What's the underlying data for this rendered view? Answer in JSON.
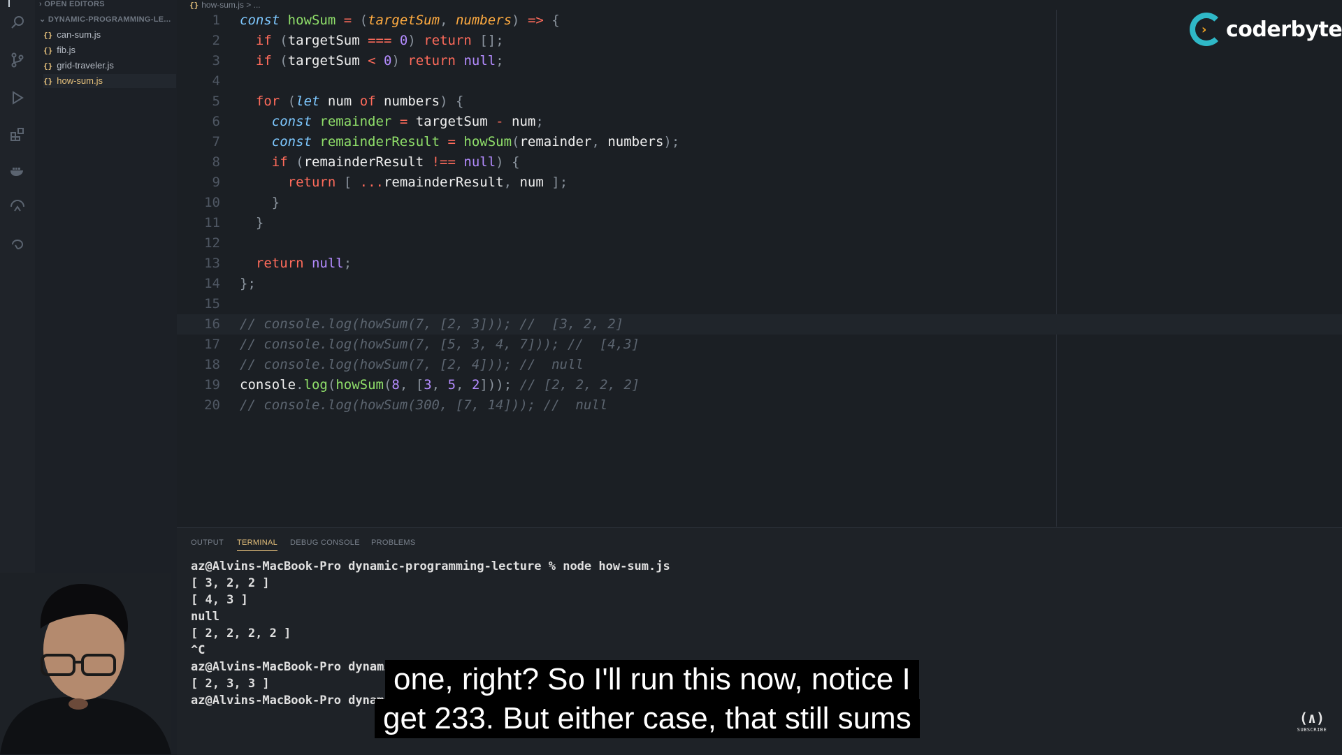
{
  "activity_bar": {
    "icons": [
      "files-icon",
      "search-icon",
      "source-control-icon",
      "run-debug-icon",
      "extensions-icon",
      "docker-icon",
      "remote-icon",
      "live-share-icon"
    ]
  },
  "sidebar": {
    "open_editors": "OPEN EDITORS",
    "folder": "DYNAMIC-PROGRAMMING-LE...",
    "files": [
      {
        "icon": "{}",
        "name": "can-sum.js"
      },
      {
        "icon": "{}",
        "name": "fib.js"
      },
      {
        "icon": "{}",
        "name": "grid-traveler.js"
      },
      {
        "icon": "{}",
        "name": "how-sum.js"
      }
    ]
  },
  "editor": {
    "breadcrumb": "how-sum.js > ...",
    "breadcrumb_icon": "{}",
    "line_numbers": [
      "1",
      "2",
      "3",
      "4",
      "5",
      "6",
      "7",
      "8",
      "9",
      "10",
      "11",
      "12",
      "13",
      "14",
      "15",
      "16",
      "17",
      "18",
      "19",
      "20"
    ],
    "code": {
      "l1": {
        "a": "const",
        "b": "howSum",
        "c": "=",
        "d": "(",
        "e": "targetSum",
        "f": ",",
        "g": "numbers",
        "h": ")",
        "i": "=>",
        "j": "{"
      },
      "l2": {
        "a": "if",
        "b": "(",
        "c": "targetSum",
        "d": "===",
        "e": "0",
        "f": ")",
        "g": "return",
        "h": "[];"
      },
      "l3": {
        "a": "if",
        "b": "(",
        "c": "targetSum",
        "d": "<",
        "e": "0",
        "f": ")",
        "g": "return",
        "h": "null",
        "i": ";"
      },
      "l5": {
        "a": "for",
        "b": "(",
        "c": "let",
        "d": "num",
        "e": "of",
        "f": "numbers",
        "g": ")",
        "h": "{"
      },
      "l6": {
        "a": "const",
        "b": "remainder",
        "c": "=",
        "d": "targetSum",
        "e": "-",
        "f": "num",
        "g": ";"
      },
      "l7": {
        "a": "const",
        "b": "remainderResult",
        "c": "=",
        "d": "howSum",
        "e": "(",
        "f": "remainder",
        "g": ",",
        "h": "numbers",
        "i": ");"
      },
      "l8": {
        "a": "if",
        "b": "(",
        "c": "remainderResult",
        "d": "!==",
        "e": "null",
        "f": ")",
        "g": "{"
      },
      "l9": {
        "a": "return",
        "b": "[",
        "c": "...",
        "d": "remainderResult",
        "e": ",",
        "f": "num",
        "g": "];"
      },
      "l10": {
        "a": "}"
      },
      "l11": {
        "a": "}"
      },
      "l13": {
        "a": "return",
        "b": "null",
        "c": ";"
      },
      "l14": {
        "a": "};"
      },
      "l16": "// console.log(howSum(7, [2, 3])); //  [3, 2, 2]",
      "l17": "// console.log(howSum(7, [5, 3, 4, 7])); //  [4,3]",
      "l18": "// console.log(howSum(7, [2, 4])); //  null",
      "l19": {
        "a": "console",
        "b": ".",
        "c": "log",
        "d": "(",
        "e": "howSum",
        "f": "(",
        "g": "8",
        "h": ",",
        "i": "[",
        "j": "3",
        "k": ",",
        "l": "5",
        "m": ",",
        "n": "2",
        "o": "]));",
        "p": "// [2, 2, 2, 2]"
      },
      "l20": "// console.log(howSum(300, [7, 14])); //  null"
    }
  },
  "panel": {
    "tabs": [
      "OUTPUT",
      "TERMINAL",
      "DEBUG CONSOLE",
      "PROBLEMS"
    ],
    "active_tab": "TERMINAL",
    "terminal_lines": [
      "az@Alvins-MacBook-Pro dynamic-programming-lecture % node how-sum.js",
      "[ 3, 2, 2 ]",
      "[ 4, 3 ]",
      "null",
      "[ 2, 2, 2, 2 ]",
      "^C",
      "az@Alvins-MacBook-Pro dynamic-programming-lecture % node how-sum.js",
      "[ 2, 3, 3 ]",
      "az@Alvins-MacBook-Pro dynamic-programming-lecture % "
    ]
  },
  "logo": {
    "text": "coderbyte"
  },
  "caption": {
    "line1": "one, right? So I'll run this now, notice I",
    "line2": "get 233. But either case, that still sums"
  },
  "badge": {
    "glyph": "(∧)",
    "label": "SUBSCRIBE"
  },
  "colors": {
    "keyword": "#ff6b5b",
    "function": "#90e06a",
    "storage": "#7ec8ff",
    "param": "#ffab40",
    "number": "#b48cff",
    "comment": "#5c6570",
    "accent": "#e5c07b",
    "logo": "#2fb8c7"
  }
}
